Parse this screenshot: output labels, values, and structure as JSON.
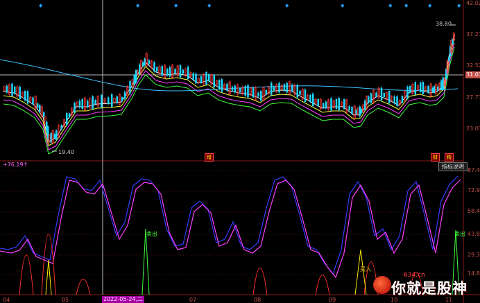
{
  "price_axis": [
    "42.02",
    "37.27",
    "32.52",
    "27.77",
    "23.03"
  ],
  "current_price_tag": "31.03",
  "high_annotation": "38.80",
  "low_annotation": "19.40",
  "date_axis": [
    "04",
    "05",
    "2022-05-24,二",
    "07",
    "08",
    "09",
    "10",
    "11"
  ],
  "indicator_label": "+76.19↑",
  "help_button": "指标说明",
  "osc_axis": [
    "87.4",
    "72.9",
    "58.4",
    "43.8",
    "29.3",
    "14.8"
  ],
  "markers": {
    "sell1": "卖出",
    "sell2": "卖出",
    "buy1": "买入"
  },
  "badges": {
    "b1": "增",
    "b2": "财",
    "b3": "精"
  },
  "watermark": {
    "domain": "634.cn",
    "text": "你就是股神"
  },
  "colors": {
    "up": "#ff3a3a",
    "down": "#20d8ff",
    "k": "#3a3aff",
    "d": "#ff40ff",
    "axis": "#c8504a"
  }
}
